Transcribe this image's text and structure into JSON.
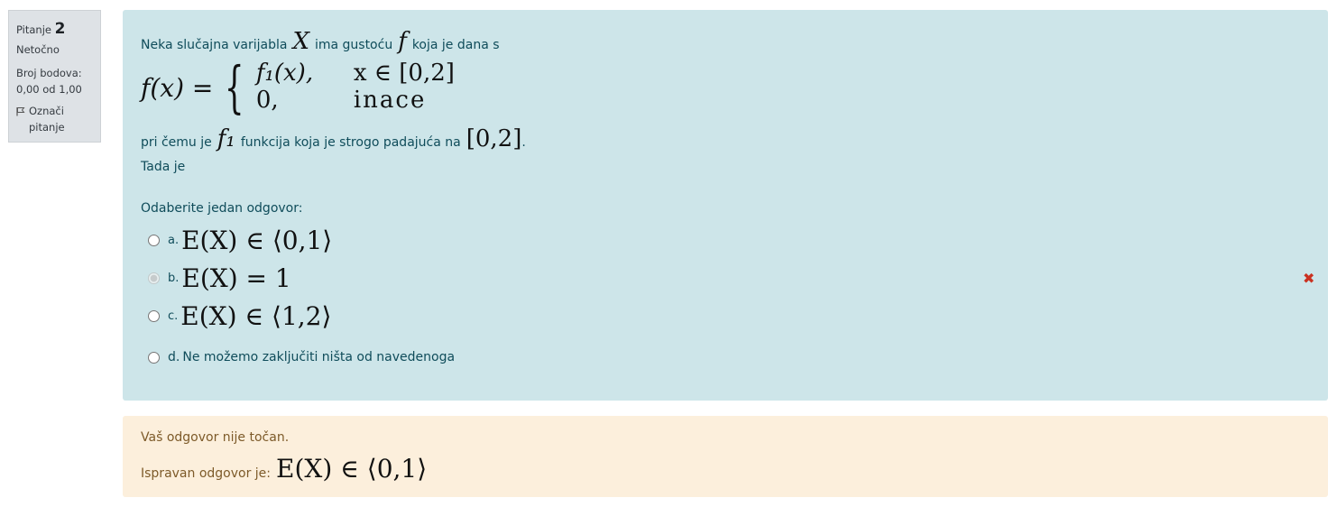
{
  "info": {
    "question_label": "Pitanje",
    "question_number": "2",
    "state": "Netočno",
    "grade_label": "Broj bodova:",
    "grade_value": "0,00 od 1,00",
    "flag_label": "Označi",
    "flag_label_2": "pitanje"
  },
  "question": {
    "intro_1": "Neka slučajna varijabla",
    "var_X": "X",
    "intro_2": "ima gustoću",
    "var_f": "f",
    "intro_3": "koja je dana s",
    "formula_lhs": "f(x) =",
    "case1_expr": "f₁(x),",
    "case1_cond": "x ∈ [0,2]",
    "case2_expr": "0,",
    "case2_cond": "inace",
    "line3_a": "pri čemu je",
    "f1": "f₁",
    "line3_b": "funkcija koja je strogo padajuća na",
    "interval": "[0,2]",
    "line3_end": ".",
    "tada": "Tada je",
    "prompt": "Odaberite jedan odgovor:",
    "answers": [
      {
        "letter": "a.",
        "math": "E(X) ∈ ⟨0,1⟩",
        "selected": false
      },
      {
        "letter": "b.",
        "math": "E(X) = 1",
        "selected": true
      },
      {
        "letter": "c.",
        "math": "E(X) ∈ ⟨1,2⟩",
        "selected": false
      },
      {
        "letter": "d.",
        "text": "Ne možemo zaključiti ništa od navedenoga",
        "selected": false
      }
    ],
    "wrong_mark": "✖"
  },
  "feedback": {
    "incorrect": "Vaš odgovor nije točan.",
    "right_answer_label": "Ispravan odgovor je:",
    "right_answer_math": "E(X) ∈ ⟨0,1⟩"
  },
  "colors": {
    "formulation_bg": "#cde5e9",
    "outcome_bg": "#fcefdc",
    "wrong": "#ca3120"
  }
}
